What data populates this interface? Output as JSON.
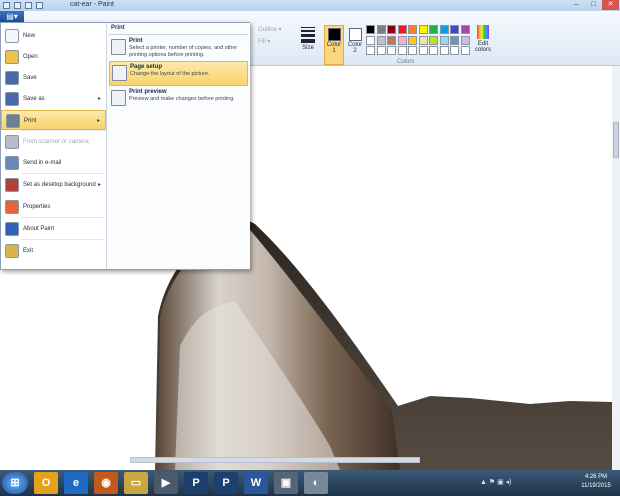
{
  "window": {
    "title": "cat-ear - Paint",
    "min": "–",
    "max": "□",
    "close": "✕"
  },
  "ribbon": {
    "file_tab": "▤▾",
    "outline_label": "Outline ▾",
    "fill_label": "Fill ▾",
    "size_label": "Size",
    "color1_label": "Color 1",
    "color2_label": "Color 2",
    "colors_group_label": "Colors",
    "edit_colors_label": "Edit colors",
    "palette_row1": [
      "#000000",
      "#7f7f7f",
      "#880015",
      "#ed1c24",
      "#ff7f27",
      "#fff200",
      "#22b14c",
      "#00a2e8",
      "#3f48cc",
      "#a349a4"
    ],
    "palette_row2": [
      "#ffffff",
      "#c3c3c3",
      "#b97a57",
      "#ffaec9",
      "#ffc90e",
      "#efe4b0",
      "#b5e61d",
      "#99d9ea",
      "#7092be",
      "#c8bfe7"
    ],
    "palette_row3": [
      "#ffffff",
      "#ffffff",
      "#ffffff",
      "#ffffff",
      "#ffffff",
      "#ffffff",
      "#ffffff",
      "#ffffff",
      "#ffffff",
      "#ffffff"
    ],
    "color1_value": "#000000",
    "color2_value": "#ffffff"
  },
  "file_menu": {
    "items": [
      {
        "label": "New",
        "icon": "new-document-icon"
      },
      {
        "label": "Open",
        "icon": "open-folder-icon"
      },
      {
        "label": "Save",
        "icon": "save-disk-icon"
      },
      {
        "label": "Save as",
        "icon": "save-as-icon",
        "arrow": "▸"
      },
      {
        "label": "Print",
        "icon": "printer-icon",
        "arrow": "▸"
      },
      {
        "label": "From scanner or camera",
        "icon": "scanner-icon"
      },
      {
        "label": "Send in e-mail",
        "icon": "email-icon"
      },
      {
        "label": "Set as desktop background",
        "icon": "desktop-background-icon",
        "arrow": "▸"
      },
      {
        "label": "Properties",
        "icon": "checkmark-icon"
      },
      {
        "label": "About Paint",
        "icon": "info-icon"
      },
      {
        "label": "Exit",
        "icon": "exit-icon"
      }
    ],
    "submenu_title": "Print",
    "submenu": [
      {
        "title": "Print",
        "desc": "Select a printer, number of copies, and other printing options before printing."
      },
      {
        "title": "Page setup",
        "desc": "Change the layout of the picture."
      },
      {
        "title": "Print preview",
        "desc": "Preview and make changes before printing."
      }
    ]
  },
  "taskbar": {
    "start": "⊞",
    "apps": [
      "O",
      "e",
      "◉",
      "▭",
      "▶",
      "P",
      "P",
      "W",
      "▣",
      "◐"
    ],
    "time": "4:26 PM",
    "date": "11/19/2015",
    "tray": "▲ ⚑ ▣ ◂)"
  }
}
